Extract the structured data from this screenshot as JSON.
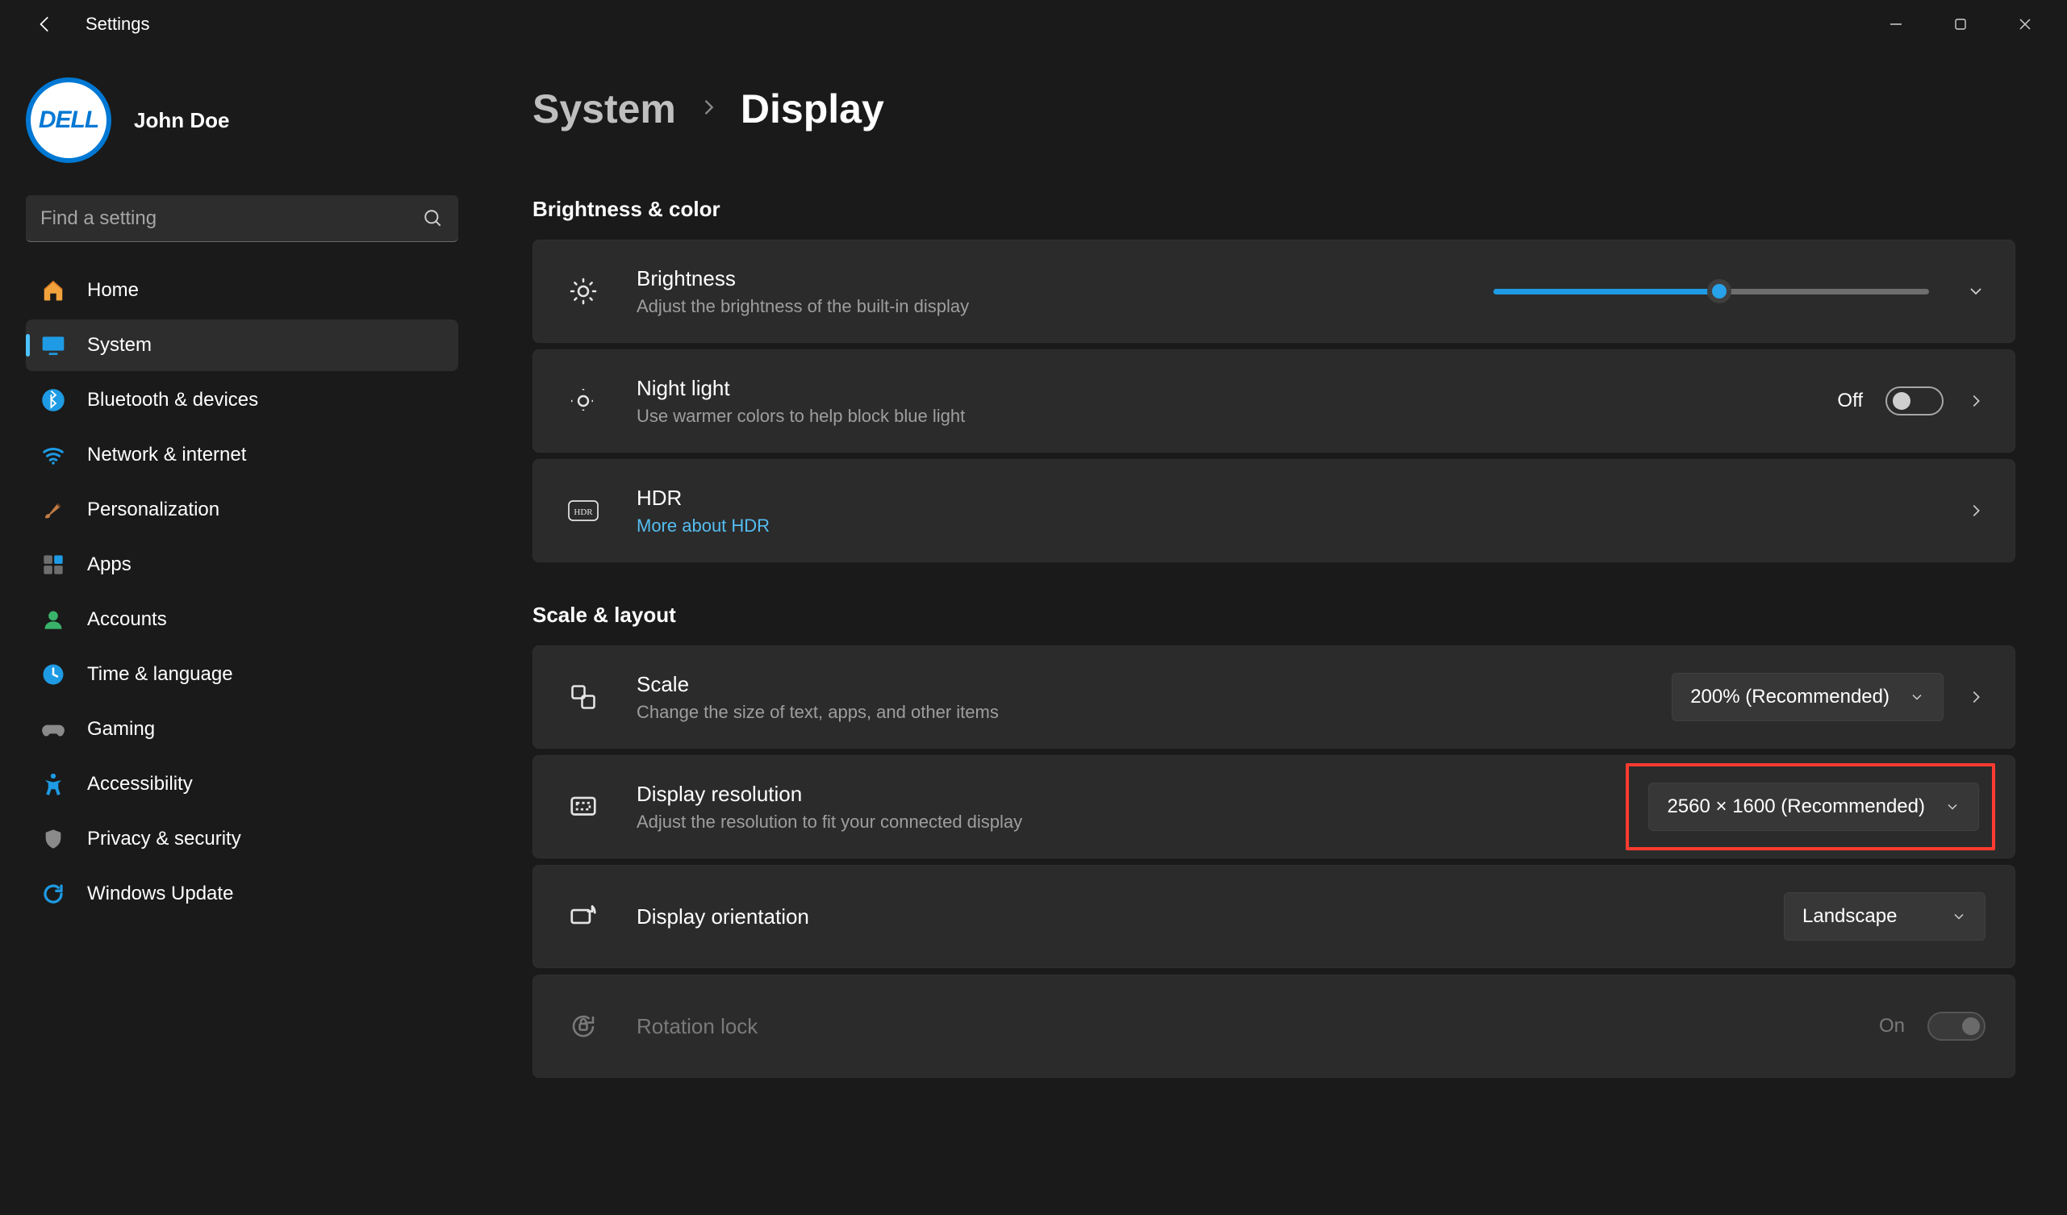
{
  "app_title": "Settings",
  "user": {
    "name": "John Doe",
    "avatar_text": "DELL"
  },
  "search": {
    "placeholder": "Find a setting"
  },
  "nav": {
    "items": [
      {
        "label": "Home"
      },
      {
        "label": "System"
      },
      {
        "label": "Bluetooth & devices"
      },
      {
        "label": "Network & internet"
      },
      {
        "label": "Personalization"
      },
      {
        "label": "Apps"
      },
      {
        "label": "Accounts"
      },
      {
        "label": "Time & language"
      },
      {
        "label": "Gaming"
      },
      {
        "label": "Accessibility"
      },
      {
        "label": "Privacy & security"
      },
      {
        "label": "Windows Update"
      }
    ],
    "active_index": 1
  },
  "breadcrumb": {
    "parent": "System",
    "current": "Display"
  },
  "sections": {
    "brightness_color": {
      "title": "Brightness & color",
      "brightness": {
        "title": "Brightness",
        "sub": "Adjust the brightness of the built-in display",
        "value": 52
      },
      "night_light": {
        "title": "Night light",
        "sub": "Use warmer colors to help block blue light",
        "state_label": "Off",
        "on": false
      },
      "hdr": {
        "title": "HDR",
        "link": "More about HDR"
      }
    },
    "scale_layout": {
      "title": "Scale & layout",
      "scale": {
        "title": "Scale",
        "sub": "Change the size of text, apps, and other items",
        "value": "200% (Recommended)"
      },
      "resolution": {
        "title": "Display resolution",
        "sub": "Adjust the resolution to fit your connected display",
        "value": "2560 × 1600 (Recommended)"
      },
      "orientation": {
        "title": "Display orientation",
        "value": "Landscape"
      },
      "rotation_lock": {
        "title": "Rotation lock",
        "state_label": "On",
        "on": true,
        "disabled": true
      }
    }
  },
  "colors": {
    "accent": "#4cc2ff",
    "link": "#55bdf2"
  },
  "highlight": {
    "target": "resolution-dropdown"
  }
}
